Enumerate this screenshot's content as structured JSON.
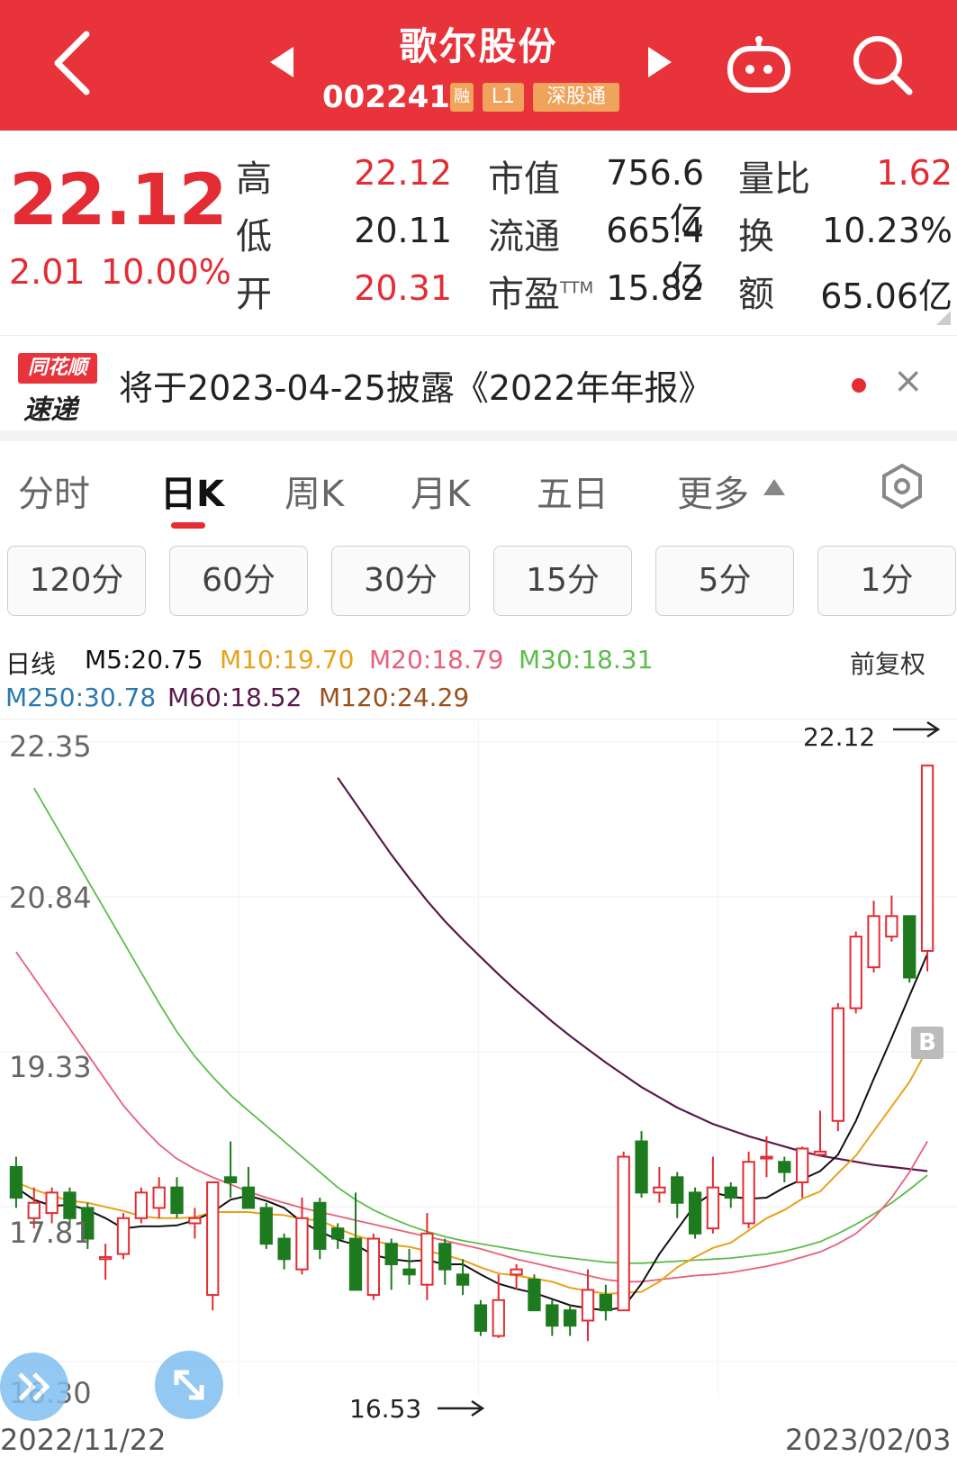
{
  "header": {
    "title": "歌尔股份",
    "code": "002241",
    "badges": {
      "rong": "融",
      "level": "L1",
      "connect": "深股通"
    }
  },
  "quote": {
    "price": "22.12",
    "change": "2.01",
    "change_pct": "10.00%",
    "high_label": "高",
    "high": "22.12",
    "low_label": "低",
    "low": "20.11",
    "open_label": "开",
    "open": "20.31",
    "mktcap_label": "市值",
    "mktcap": "756.6亿",
    "float_label": "流通",
    "float": "665.4亿",
    "pe_label": "市盈",
    "pe_sup": "TTM",
    "pe": "15.82",
    "vr_label": "量比",
    "vr": "1.62",
    "turnover_label": "换",
    "turnover": "10.23%",
    "amount_label": "额",
    "amount": "65.06亿"
  },
  "notice": {
    "logo_top": "同花顺",
    "logo_bottom": "速递",
    "text": "将于2023-04-25披露《2022年年报》",
    "close": "×"
  },
  "tabs": [
    "分时",
    "日K",
    "周K",
    "月K",
    "五日",
    "更多"
  ],
  "active_tab": "日K",
  "periods": [
    "120分",
    "60分",
    "30分",
    "15分",
    "5分",
    "1分"
  ],
  "legend": {
    "type": "日线",
    "ma5": "M5:20.75",
    "ma10": "M10:19.70",
    "ma20": "M20:18.79",
    "ma30": "M30:18.31",
    "adjust": "前复权",
    "ma250": "M250:30.78",
    "ma60": "M60:18.52",
    "ma120": "M120:24.29"
  },
  "colors": {
    "up": "#e32c33",
    "down": "#1e7a1e",
    "ma5": "#111111",
    "ma10": "#e8a21a",
    "ma20": "#e8607a",
    "ma30": "#5cbd4a",
    "ma60": "#5a1a4a",
    "ma120": "#9a5020",
    "ma250": "#2a7ab0"
  },
  "chart_data": {
    "type": "candlestick",
    "y_ticks": [
      "22.35",
      "20.84",
      "19.33",
      "17.81",
      "16.30"
    ],
    "ylim": [
      16.3,
      22.35
    ],
    "x_range": [
      "2022/11/22",
      "2023/02/03"
    ],
    "max_label": "22.12",
    "min_label": "16.53",
    "marker": "B",
    "candles": [
      {
        "o": 18.2,
        "c": 17.9,
        "h": 18.3,
        "l": 17.8
      },
      {
        "o": 17.7,
        "c": 17.85,
        "h": 18.0,
        "l": 17.6
      },
      {
        "o": 17.75,
        "c": 17.95,
        "h": 18.0,
        "l": 17.65
      },
      {
        "o": 17.95,
        "c": 17.7,
        "h": 18.0,
        "l": 17.6
      },
      {
        "o": 17.8,
        "c": 17.5,
        "h": 17.85,
        "l": 17.4
      },
      {
        "o": 17.3,
        "c": 17.32,
        "h": 17.45,
        "l": 17.1
      },
      {
        "o": 17.35,
        "c": 17.7,
        "h": 17.75,
        "l": 17.3
      },
      {
        "o": 17.7,
        "c": 17.95,
        "h": 18.0,
        "l": 17.65
      },
      {
        "o": 17.8,
        "c": 18.0,
        "h": 18.1,
        "l": 17.7
      },
      {
        "o": 18.0,
        "c": 17.75,
        "h": 18.1,
        "l": 17.7
      },
      {
        "o": 17.65,
        "c": 17.7,
        "h": 17.8,
        "l": 17.5
      },
      {
        "o": 16.95,
        "c": 18.05,
        "h": 18.05,
        "l": 16.8
      },
      {
        "o": 18.1,
        "c": 18.05,
        "h": 18.45,
        "l": 17.9
      },
      {
        "o": 18.0,
        "c": 17.8,
        "h": 18.2,
        "l": 17.8
      },
      {
        "o": 17.8,
        "c": 17.45,
        "h": 17.85,
        "l": 17.4
      },
      {
        "o": 17.5,
        "c": 17.3,
        "h": 17.55,
        "l": 17.2
      },
      {
        "o": 17.2,
        "c": 17.7,
        "h": 17.9,
        "l": 17.15
      },
      {
        "o": 17.85,
        "c": 17.4,
        "h": 17.9,
        "l": 17.3
      },
      {
        "o": 17.6,
        "c": 17.5,
        "h": 17.65,
        "l": 17.4
      },
      {
        "o": 17.5,
        "c": 17.0,
        "h": 17.95,
        "l": 17.0
      },
      {
        "o": 16.95,
        "c": 17.5,
        "h": 17.55,
        "l": 16.9
      },
      {
        "o": 17.45,
        "c": 17.25,
        "h": 17.5,
        "l": 17.0
      },
      {
        "o": 17.2,
        "c": 17.15,
        "h": 17.4,
        "l": 17.05
      },
      {
        "o": 17.05,
        "c": 17.55,
        "h": 17.75,
        "l": 16.9
      },
      {
        "o": 17.45,
        "c": 17.2,
        "h": 17.5,
        "l": 17.05
      },
      {
        "o": 17.15,
        "c": 17.05,
        "h": 17.3,
        "l": 16.95
      },
      {
        "o": 16.85,
        "c": 16.6,
        "h": 16.9,
        "l": 16.55
      },
      {
        "o": 16.55,
        "c": 16.9,
        "h": 17.15,
        "l": 16.53
      },
      {
        "o": 17.15,
        "c": 17.2,
        "h": 17.25,
        "l": 17.0
      },
      {
        "o": 17.1,
        "c": 16.8,
        "h": 17.15,
        "l": 16.8
      },
      {
        "o": 16.85,
        "c": 16.65,
        "h": 16.9,
        "l": 16.55
      },
      {
        "o": 16.8,
        "c": 16.65,
        "h": 16.85,
        "l": 16.55
      },
      {
        "o": 16.7,
        "c": 17.0,
        "h": 17.2,
        "l": 16.5
      },
      {
        "o": 16.95,
        "c": 16.8,
        "h": 17.05,
        "l": 16.7
      },
      {
        "o": 16.8,
        "c": 18.3,
        "h": 18.35,
        "l": 16.8
      },
      {
        "o": 18.45,
        "c": 17.95,
        "h": 18.55,
        "l": 17.9
      },
      {
        "o": 17.95,
        "c": 18.0,
        "h": 18.2,
        "l": 17.85
      },
      {
        "o": 18.1,
        "c": 17.85,
        "h": 18.15,
        "l": 17.7
      },
      {
        "o": 17.95,
        "c": 17.55,
        "h": 18.0,
        "l": 17.5
      },
      {
        "o": 17.6,
        "c": 18.0,
        "h": 18.3,
        "l": 17.55
      },
      {
        "o": 18.0,
        "c": 17.9,
        "h": 18.05,
        "l": 17.8
      },
      {
        "o": 17.65,
        "c": 18.25,
        "h": 18.35,
        "l": 17.6
      },
      {
        "o": 18.3,
        "c": 18.3,
        "h": 18.5,
        "l": 18.1
      },
      {
        "o": 18.25,
        "c": 18.15,
        "h": 18.3,
        "l": 18.05
      },
      {
        "o": 18.05,
        "c": 18.38,
        "h": 18.4,
        "l": 17.9
      },
      {
        "o": 18.32,
        "c": 18.35,
        "h": 18.75,
        "l": 18.3
      },
      {
        "o": 18.65,
        "c": 19.75,
        "h": 19.8,
        "l": 18.55
      },
      {
        "o": 19.75,
        "c": 20.45,
        "h": 20.5,
        "l": 19.7
      },
      {
        "o": 20.15,
        "c": 20.65,
        "h": 20.8,
        "l": 20.1
      },
      {
        "o": 20.45,
        "c": 20.65,
        "h": 20.85,
        "l": 20.4
      },
      {
        "o": 20.65,
        "c": 20.05,
        "h": 20.65,
        "l": 20.0
      },
      {
        "o": 20.31,
        "c": 22.12,
        "h": 22.12,
        "l": 20.11
      }
    ],
    "ma": {
      "ma5": [
        18.0,
        17.88,
        17.82,
        17.83,
        17.78,
        17.7,
        17.6,
        17.62,
        17.62,
        17.63,
        17.68,
        17.76,
        17.88,
        17.92,
        17.87,
        17.8,
        17.66,
        17.57,
        17.49,
        17.44,
        17.34,
        17.3,
        17.28,
        17.29,
        17.25,
        17.25,
        17.15,
        17.06,
        17.01,
        16.97,
        16.91,
        16.85,
        16.82,
        16.8,
        16.83,
        17.06,
        17.35,
        17.59,
        17.83,
        17.95,
        17.91,
        17.89,
        17.9,
        18.0,
        18.08,
        18.16,
        18.32,
        18.65,
        19.06,
        19.46,
        19.87,
        20.28
      ],
      "ma10": [
        18.05,
        17.98,
        17.92,
        17.87,
        17.85,
        17.81,
        17.77,
        17.72,
        17.7,
        17.7,
        17.71,
        17.76,
        17.76,
        17.76,
        17.74,
        17.73,
        17.69,
        17.68,
        17.6,
        17.53,
        17.48,
        17.44,
        17.42,
        17.38,
        17.34,
        17.29,
        17.22,
        17.16,
        17.14,
        17.11,
        17.08,
        17.02,
        16.99,
        16.96,
        16.97,
        16.98,
        17.08,
        17.22,
        17.32,
        17.41,
        17.46,
        17.58,
        17.7,
        17.78,
        17.89,
        17.96,
        18.14,
        18.31,
        18.55,
        18.79,
        19.03,
        19.35
      ],
      "ma20": [
        20.3,
        20.05,
        19.8,
        19.55,
        19.3,
        19.05,
        18.8,
        18.6,
        18.42,
        18.28,
        18.18,
        18.1,
        18.03,
        17.96,
        17.9,
        17.85,
        17.8,
        17.76,
        17.72,
        17.68,
        17.64,
        17.6,
        17.56,
        17.52,
        17.48,
        17.44,
        17.4,
        17.35,
        17.3,
        17.26,
        17.22,
        17.18,
        17.14,
        17.1,
        17.08,
        17.08,
        17.1,
        17.12,
        17.14,
        17.15,
        17.17,
        17.2,
        17.23,
        17.27,
        17.32,
        17.37,
        17.45,
        17.55,
        17.7,
        17.9,
        18.15,
        18.45
      ],
      "ma30": [
        null,
        21.9,
        21.6,
        21.3,
        21.0,
        20.7,
        20.4,
        20.1,
        19.8,
        19.52,
        19.28,
        19.08,
        18.9,
        18.75,
        18.6,
        18.45,
        18.3,
        18.15,
        18.0,
        17.88,
        17.78,
        17.7,
        17.63,
        17.57,
        17.52,
        17.48,
        17.45,
        17.42,
        17.39,
        17.36,
        17.33,
        17.31,
        17.29,
        17.27,
        17.26,
        17.26,
        17.27,
        17.28,
        17.29,
        17.3,
        17.31,
        17.33,
        17.35,
        17.38,
        17.42,
        17.47,
        17.55,
        17.64,
        17.74,
        17.85,
        17.98,
        18.12
      ],
      "ma60": [
        null,
        null,
        null,
        null,
        null,
        null,
        null,
        null,
        null,
        null,
        null,
        null,
        null,
        null,
        null,
        null,
        null,
        null,
        22.0,
        21.75,
        21.5,
        21.25,
        21.02,
        20.8,
        20.6,
        20.42,
        20.25,
        20.08,
        19.92,
        19.77,
        19.62,
        19.48,
        19.35,
        19.22,
        19.1,
        18.98,
        18.88,
        18.78,
        18.7,
        18.62,
        18.56,
        18.5,
        18.45,
        18.4,
        18.35,
        18.31,
        18.28,
        18.25,
        18.22,
        18.2,
        18.18,
        18.16
      ]
    }
  }
}
